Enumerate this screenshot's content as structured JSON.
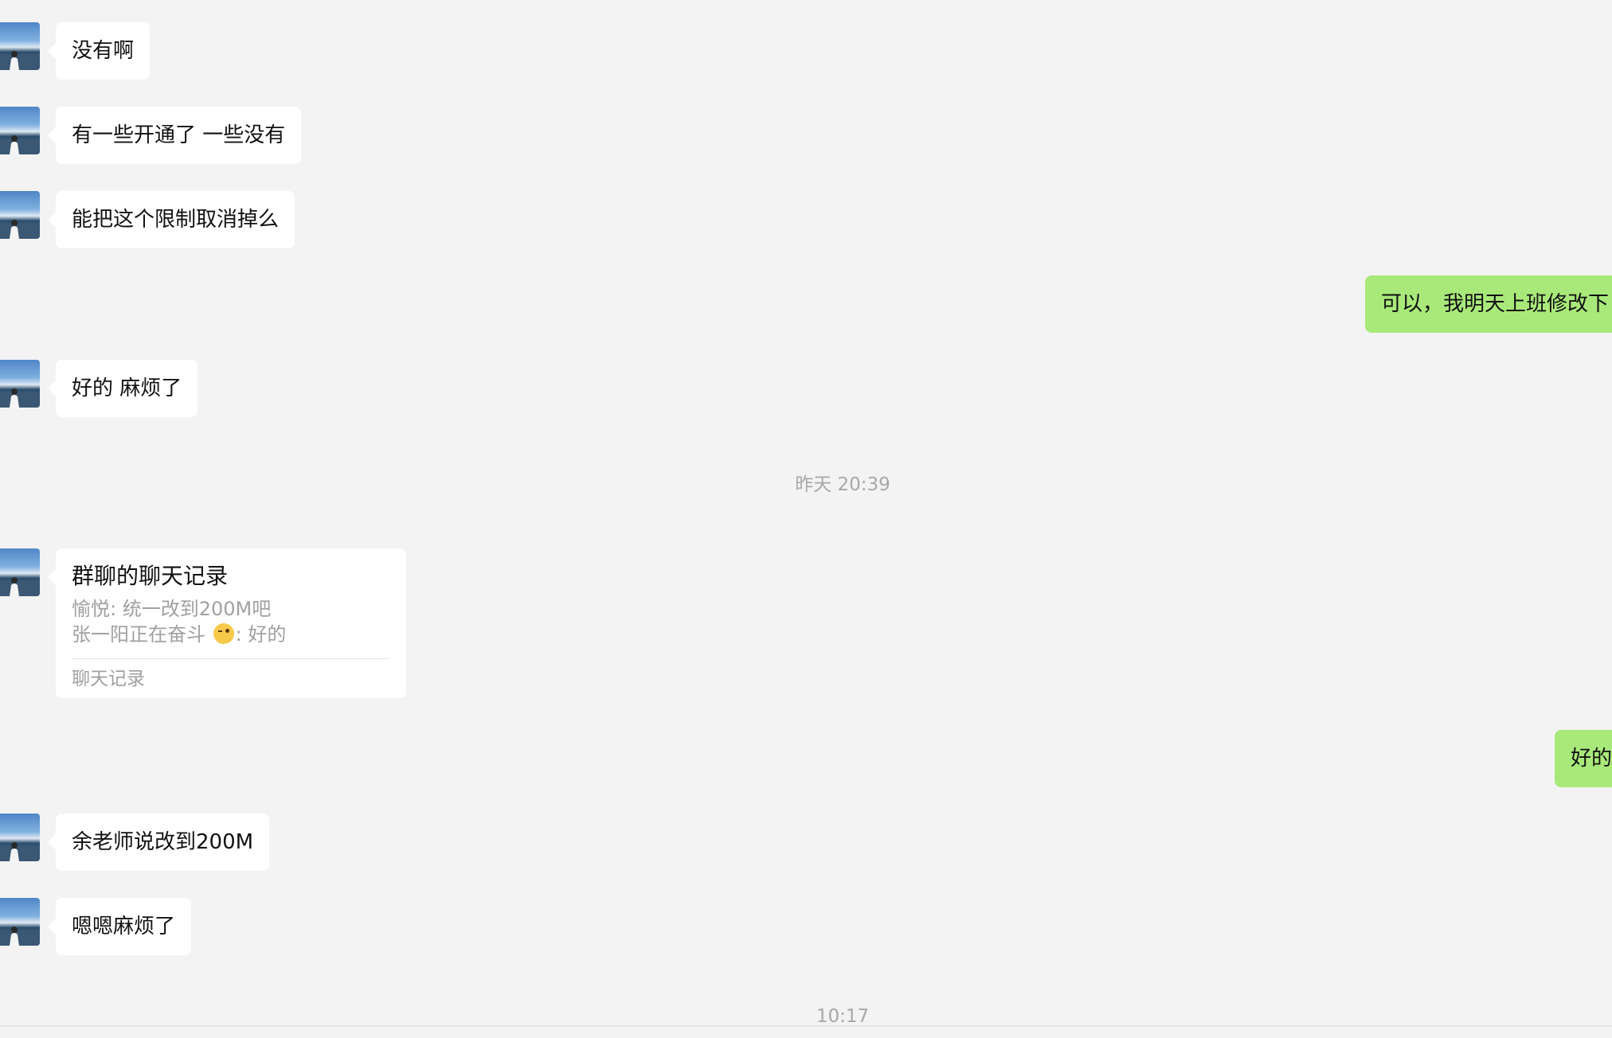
{
  "messages": [
    {
      "from": "other",
      "text": "没有啊"
    },
    {
      "from": "other",
      "text": "有一些开通了 一些没有"
    },
    {
      "from": "other",
      "text": "能把这个限制取消掉么"
    },
    {
      "from": "self",
      "text": "可以，我明天上班修改下"
    },
    {
      "from": "other",
      "text": "好的 麻烦了"
    },
    {
      "from": "other",
      "text": "余老师说改到200M"
    },
    {
      "from": "self",
      "text": "好的"
    },
    {
      "from": "other",
      "text": "嗯嗯麻烦了"
    }
  ],
  "timestamps": {
    "first": "昨天 20:39",
    "second": "10:17"
  },
  "chat_record_card": {
    "title": "群聊的聊天记录",
    "line1": "愉悦: 统一改到200M吧",
    "line2_name": "张一阳正在奋斗",
    "line2_emoji": "wink-emoji",
    "line2_text": ": 好的",
    "footer": "聊天记录"
  },
  "colors": {
    "background": "#f3f3f3",
    "incoming_bubble": "#ffffff",
    "outgoing_bubble": "#a9e97a",
    "timestamp_text": "#a8a8a8"
  }
}
